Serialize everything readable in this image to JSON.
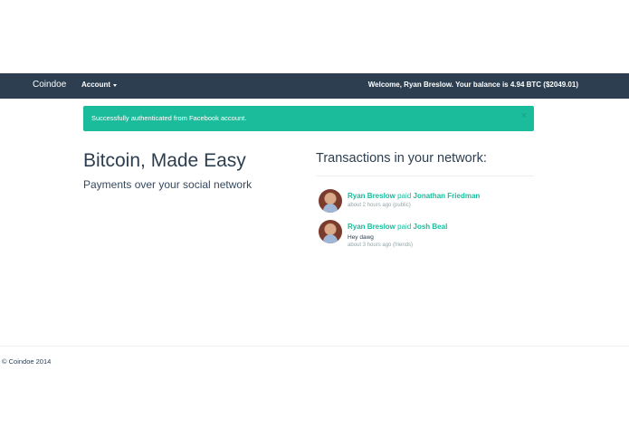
{
  "navbar": {
    "brand": "Coindoe",
    "account_label": "Account",
    "welcome": "Welcome, Ryan Breslow. Your balance is 4.94 BTC ($2049.01)"
  },
  "alert": {
    "message": "Successfully authenticated from Facebook account.",
    "close": "×"
  },
  "hero": {
    "title": "Bitcoin, Made Easy",
    "subtitle": "Payments over your social network"
  },
  "transactions": {
    "heading": "Transactions in your network:",
    "items": [
      {
        "from": "Ryan Breslow",
        "verb": "paid",
        "to": "Jonathan Friedman",
        "note": "",
        "meta": "about 2 hours ago (public)"
      },
      {
        "from": "Ryan Breslow",
        "verb": "paid",
        "to": "Josh Beal",
        "note": "Hey dawg",
        "meta": "about 3 hours ago (friends)"
      }
    ]
  },
  "footer": {
    "copyright": "© Coindoe 2014"
  }
}
